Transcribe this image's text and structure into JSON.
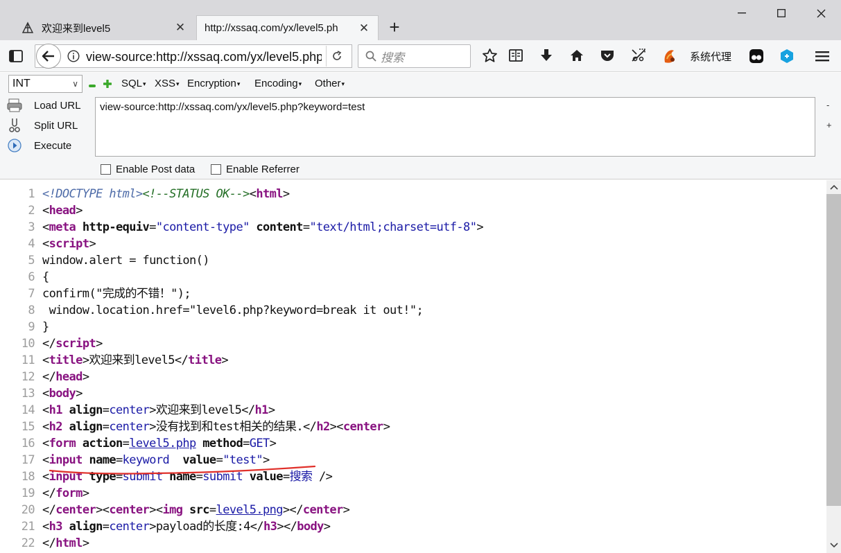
{
  "tabs": [
    {
      "title": "欢迎来到level5"
    },
    {
      "title": "http://xssaq.com/yx/level5.ph"
    }
  ],
  "nav": {
    "url": "view-source:http://xssaq.com/yx/level5.php?keyword=test",
    "search_placeholder": "搜索",
    "proxy_label": "系统代理"
  },
  "hackbar": {
    "select_value": "INT",
    "menus": [
      "SQL",
      "XSS",
      "Encryption",
      "Encoding",
      "Other"
    ],
    "load_url": "Load URL",
    "split_url": "Split URL",
    "execute": "Execute",
    "url_value": "view-source:http://xssaq.com/yx/level5.php?keyword=test",
    "minus": "-",
    "plus": "+",
    "enable_post": "Enable Post data",
    "enable_referrer": "Enable Referrer"
  },
  "source_lines": [
    "1",
    "2",
    "3",
    "4",
    "5",
    "6",
    "7",
    "8",
    "9",
    "10",
    "11",
    "12",
    "13",
    "14",
    "15",
    "16",
    "17",
    "18",
    "19",
    "20",
    "21",
    "22"
  ],
  "code": {
    "l1a": "<!DOCTYPE html>",
    "l1b": "<!--STATUS OK-->",
    "l5": "window.alert = function()",
    "l6": "{",
    "l7": "confirm(\"完成的不错！\");",
    "l8": " window.location.href=\"level6.php?keyword=break it out!\";",
    "l9": "}",
    "l11_text": "欢迎来到level5",
    "l14_text": "欢迎来到level5",
    "l15_text": "没有找到和test相关的结果.",
    "l16_action": "level5.php",
    "l16_method": "GET",
    "l17_name": "keyword",
    "l17_value": "\"test\"",
    "l18_type": "submit",
    "l18_name": "submit",
    "l18_value": "搜索",
    "l20_src": "level5.png",
    "l21_text": "payload的长度:4",
    "l3_httpequiv": "\"content-type\"",
    "l3_content": "\"text/html;charset=utf-8\"",
    "center": "center"
  },
  "colors": {
    "tabstrip_bg": "#d9d9dc",
    "toolbar_bg": "#f5f6f7",
    "element": "#881280",
    "attr_value": "#1a1aa6",
    "comment": "#236e25",
    "annotation": "#e0302a"
  },
  "icons": [
    "bookmark-star-icon",
    "reader-icon",
    "download-icon",
    "home-icon",
    "pocket-icon",
    "screenshot-icon",
    "proxy-fox-icon",
    "tampermonkey-icon",
    "extension-icon",
    "menu-icon"
  ]
}
